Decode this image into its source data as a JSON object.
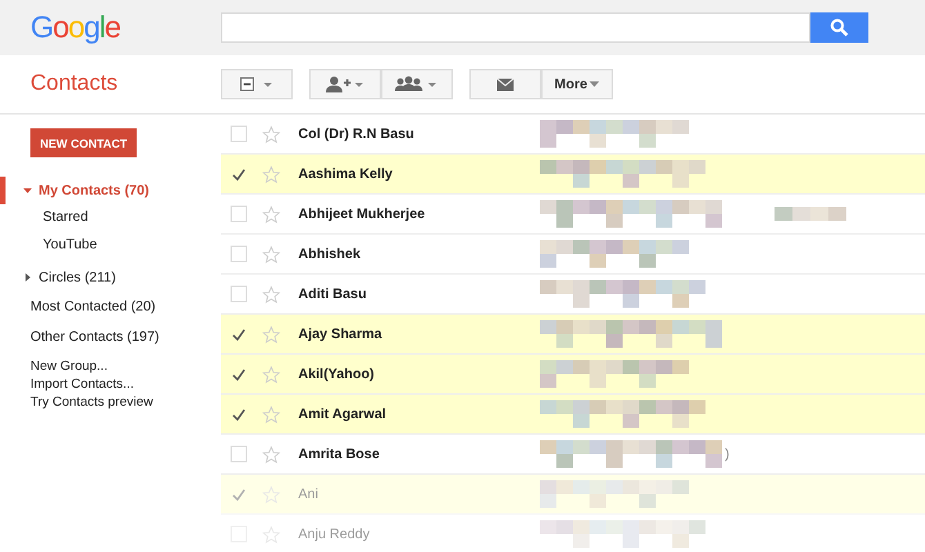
{
  "header": {
    "logo": "Google"
  },
  "app_title": "Contacts",
  "toolbar": {
    "more_label": "More"
  },
  "sidebar": {
    "new_contact": "NEW CONTACT",
    "groups": [
      {
        "label": "My Contacts (70)",
        "selected": true,
        "expanded": true,
        "children": [
          {
            "label": "Starred"
          },
          {
            "label": "YouTube"
          }
        ]
      },
      {
        "label": "Circles (211)",
        "selected": false,
        "expanded": false
      }
    ],
    "lists": [
      "Most Contacted (20)",
      "Other Contacts (197)"
    ],
    "links": [
      "New Group...",
      "Import Contacts...",
      "Try Contacts preview"
    ]
  },
  "contacts": [
    {
      "name": "Col (Dr) R.N Basu",
      "checked": false,
      "faded": false
    },
    {
      "name": "Aashima Kelly",
      "checked": true,
      "faded": false
    },
    {
      "name": "Abhijeet Mukherjee",
      "checked": false,
      "faded": false
    },
    {
      "name": "Abhishek",
      "checked": false,
      "faded": false
    },
    {
      "name": "Aditi Basu",
      "checked": false,
      "faded": false
    },
    {
      "name": "Ajay Sharma",
      "checked": true,
      "faded": false
    },
    {
      "name": "Akil(Yahoo)",
      "checked": true,
      "faded": false
    },
    {
      "name": "Amit Agarwal",
      "checked": true,
      "faded": false
    },
    {
      "name": "Amrita Bose",
      "checked": false,
      "faded": false,
      "email_tail": ")"
    },
    {
      "name": "Ani",
      "checked": true,
      "faded": true
    },
    {
      "name": "Anju Reddy",
      "checked": false,
      "faded": true
    }
  ]
}
